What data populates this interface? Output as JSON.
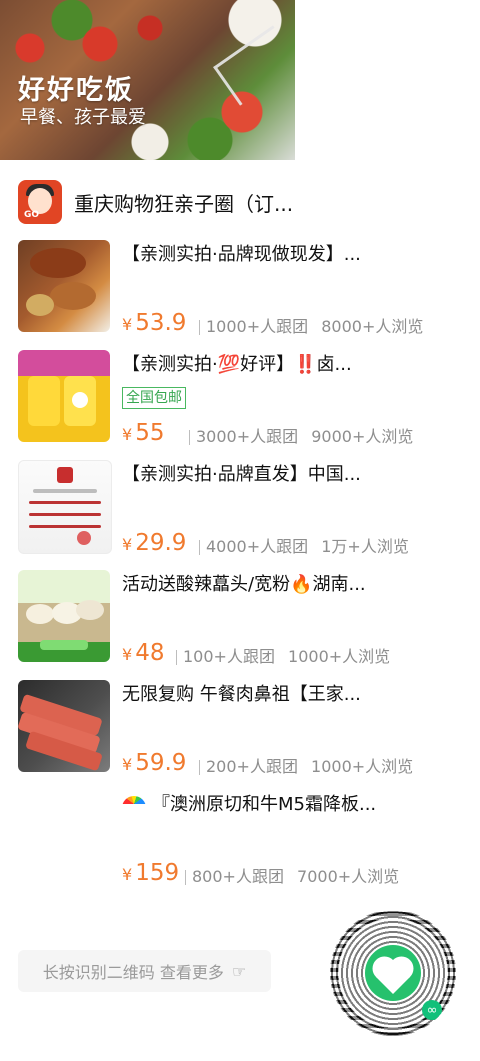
{
  "hero": {
    "title": "好好吃饭",
    "subtitle": "早餐、孩子最爱"
  },
  "group": {
    "name": "重庆购物狂亲子圈（订..."
  },
  "items": [
    {
      "title": "【亲测实拍·品牌现做现发】...",
      "price_symbol": "¥",
      "price": "53.9",
      "followers": "1000+人跟团",
      "views": "8000+人浏览",
      "thumbnail": "braised-chicken-wings-image"
    },
    {
      "title": "【亲测实拍·💯好评】‼️卤...",
      "tag": "全国包邮",
      "price_symbol": "¥",
      "price": "55",
      "followers": "3000+人跟团",
      "views": "9000+人浏览",
      "thumbnail": "yellow-snack-packs-image"
    },
    {
      "title": "【亲测实拍·品牌直发】中国...",
      "price_symbol": "¥",
      "price": "29.9",
      "followers": "4000+人跟团",
      "views": "1万+人浏览",
      "thumbnail": "certificate-image"
    },
    {
      "title": "活动送酸辣藠头/宽粉🔥湖南...",
      "price_symbol": "¥",
      "price": "48",
      "followers": "100+人跟团",
      "views": "1000+人浏览",
      "thumbnail": "handmade-food-package-image"
    },
    {
      "title": "无限复购 午餐肉鼻祖【王家...",
      "price_symbol": "¥",
      "price": "59.9",
      "followers": "200+人跟团",
      "views": "1000+人浏览",
      "thumbnail": "luncheon-meat-image"
    },
    {
      "title": "『澳洲原切和牛M5霜降板...",
      "price_symbol": "¥",
      "price": "159",
      "followers": "800+人跟团",
      "views": "7000+人浏览",
      "thumbnail": "rainbow-icon"
    }
  ],
  "footer": {
    "button_text": "长按识别二维码 查看更多",
    "arrow_icon": "hand-point-right-icon"
  },
  "colors": {
    "price": "#f07a2e",
    "tag": "#36a64f",
    "muted": "#8e8e8e",
    "qr_green": "#26c16d"
  }
}
